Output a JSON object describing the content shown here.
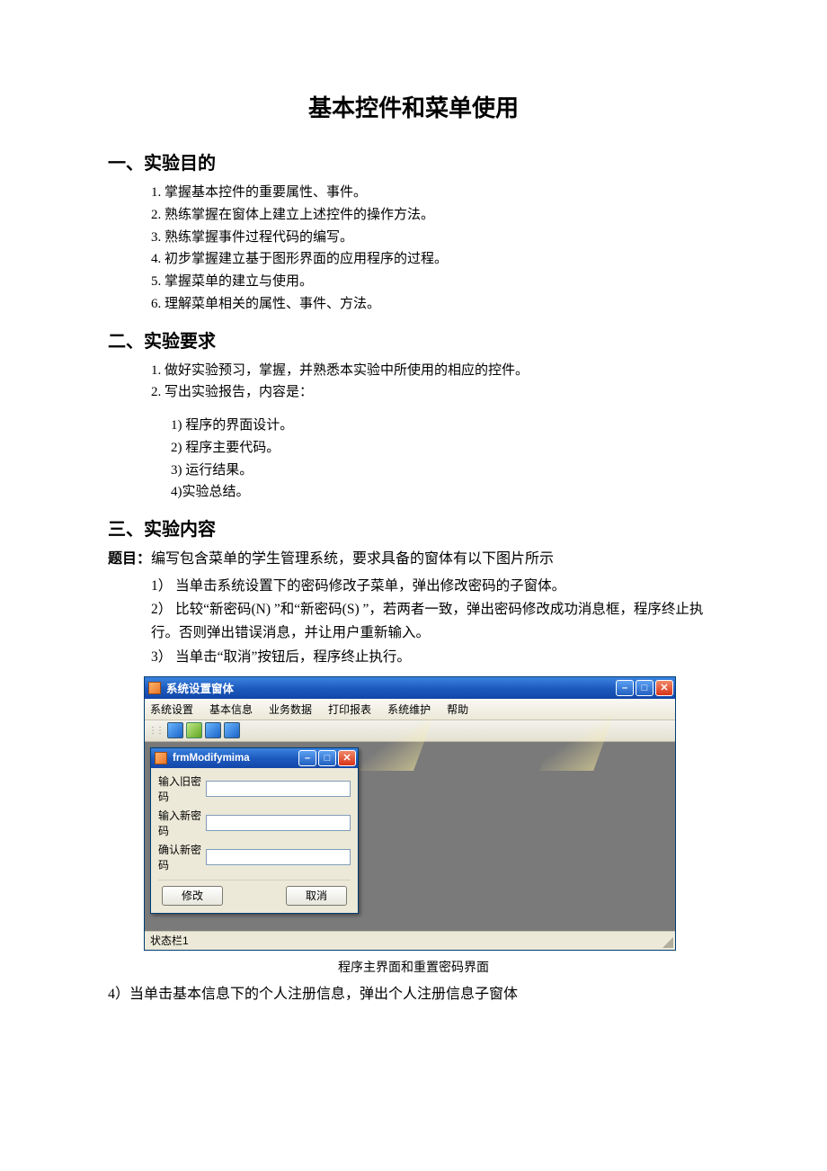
{
  "doc_title": "基本控件和菜单使用",
  "sec1": {
    "head": "一、实验目的",
    "items": [
      "掌握基本控件的重要属性、事件。",
      "熟练掌握在窗体上建立上述控件的操作方法。",
      "熟练掌握事件过程代码的编写。",
      "初步掌握建立基于图形界面的应用程序的过程。",
      "掌握菜单的建立与使用。",
      "理解菜单相关的属性、事件、方法。"
    ]
  },
  "sec2": {
    "head": "二、实验要求",
    "items": [
      "做好实验预习，掌握，并熟悉本实验中所使用的相应的控件。",
      "写出实验报告，内容是："
    ],
    "sub": [
      "1) 程序的界面设计。",
      "2) 程序主要代码。",
      "3) 运行结果。",
      "4)实验总结。"
    ]
  },
  "sec3": {
    "head": "三、实验内容",
    "topic_label": "题目：",
    "topic_text": "编写包含菜单的学生管理系统，要求具备的窗体有以下图片所示",
    "steps": [
      "1） 当单击系统设置下的密码修改子菜单，弹出修改密码的子窗体。",
      "2） 比较“新密码(N) ”和“新密码(S) ”，若两者一致，弹出密码修改成功消息框，程序终止执行。否则弹出错误消息，并让用户重新输入。",
      "3） 当单击“取消”按钮后，程序终止执行。"
    ]
  },
  "app": {
    "main_title": "系统设置窗体",
    "menus": [
      "系统设置",
      "基本信息",
      "业务数据",
      "打印报表",
      "系统维护",
      "帮助"
    ],
    "child_title": "frmModifymima",
    "labels": {
      "old": "输入旧密码",
      "new": "输入新密码",
      "confirm": "确认新密码"
    },
    "buttons": {
      "modify": "修改",
      "cancel": "取消"
    },
    "status": "状态栏1"
  },
  "caption": "程序主界面和重置密码界面",
  "note4": "4）当单击基本信息下的个人注册信息，弹出个人注册信息子窗体"
}
